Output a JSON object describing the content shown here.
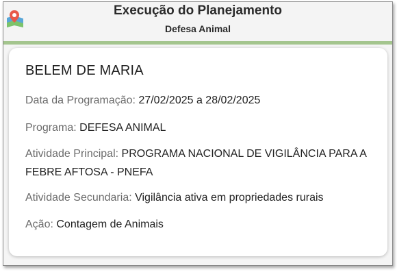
{
  "header": {
    "title": "Execução do Planejamento",
    "subtitle": "Defesa Animal",
    "logo_icon": "map-pin-icon"
  },
  "card": {
    "title": "BELEM DE MARIA",
    "fields": [
      {
        "label": "Data da Programação:",
        "value": "27/02/2025 a 28/02/2025"
      },
      {
        "label": "Programa:",
        "value": "DEFESA ANIMAL"
      },
      {
        "label": "Atividade Principal:",
        "value": "PROGRAMA NACIONAL DE VIGILÂNCIA PARA A FEBRE AFTOSA - PNEFA"
      },
      {
        "label": "Atividade Secundaria:",
        "value": "Vigilância ativa em propriedades rurais"
      },
      {
        "label": "Ação:",
        "value": "Contagem de Animais"
      }
    ]
  },
  "colors": {
    "accent_green": "#a4c58e",
    "label_gray": "#6b6b6b"
  }
}
